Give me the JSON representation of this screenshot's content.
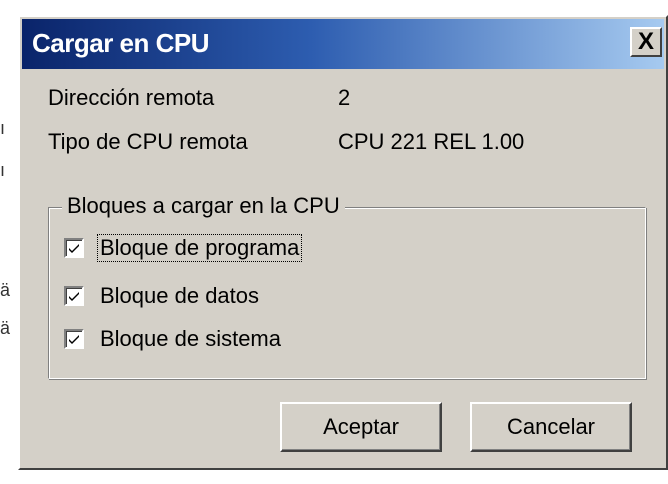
{
  "dialog": {
    "title": "Cargar en CPU",
    "close_label": "X"
  },
  "info": {
    "address_label": "Dirección remota",
    "address_value": "2",
    "cpu_type_label": "Tipo de CPU remota",
    "cpu_type_value": "CPU 221 REL 1.00"
  },
  "blocks": {
    "legend": "Bloques a cargar en la CPU",
    "items": [
      {
        "label": "Bloque de programa",
        "checked": true
      },
      {
        "label": "Bloque de datos",
        "checked": true
      },
      {
        "label": "Bloque de sistema",
        "checked": true
      }
    ]
  },
  "buttons": {
    "accept": "Aceptar",
    "cancel": "Cancelar"
  },
  "colors": {
    "title_gradient_start": "#0a246a",
    "title_gradient_end": "#a6caf0",
    "dialog_face": "#d4d0c8"
  }
}
